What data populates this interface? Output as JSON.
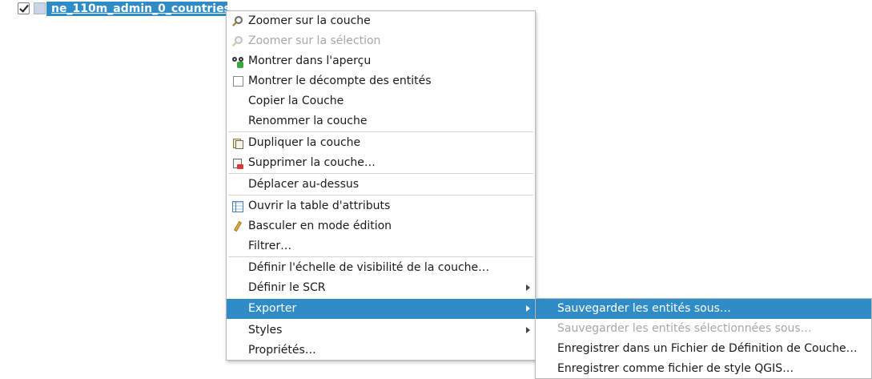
{
  "layer": {
    "name": "ne_110m_admin_0_countries",
    "checked": true
  },
  "menu": {
    "items": [
      {
        "label": "Zoomer sur la couche",
        "icon": "zoom-layer-icon"
      },
      {
        "label": "Zoomer sur la sélection",
        "icon": "zoom-selection-icon",
        "disabled": true
      },
      {
        "label": "Montrer dans l'aperçu",
        "icon": "overview-glasses-icon"
      },
      {
        "label": "Montrer le décompte des entités",
        "icon": "checkbox-icon"
      },
      {
        "label": "Copier la Couche"
      },
      {
        "label": "Renommer la couche"
      },
      {
        "label": "Dupliquer la couche",
        "icon": "duplicate-layer-icon"
      },
      {
        "label": "Supprimer la couche…",
        "icon": "remove-layer-icon"
      },
      {
        "label": "Déplacer au-dessus"
      },
      {
        "label": "Ouvrir la table d'attributs",
        "icon": "attribute-table-icon"
      },
      {
        "label": "Basculer en mode édition",
        "icon": "pencil-icon"
      },
      {
        "label": "Filtrer…"
      },
      {
        "label": "Définir l'échelle de visibilité de la couche…"
      },
      {
        "label": "Définir le SCR",
        "submenu": true
      },
      {
        "label": "Exporter",
        "submenu": true,
        "active": true
      },
      {
        "label": "Styles",
        "submenu": true
      },
      {
        "label": "Propriétés…"
      }
    ]
  },
  "submenu": {
    "items": [
      {
        "label": "Sauvegarder les entités sous…",
        "active": true
      },
      {
        "label": "Sauvegarder les entités sélectionnées sous…",
        "disabled": true
      },
      {
        "label": "Enregistrer dans un Fichier de Définition de Couche…"
      },
      {
        "label": "Enregistrer comme fichier de style QGIS…"
      }
    ]
  },
  "colors": {
    "highlight": "#308cc6",
    "disabled_text": "#a7a7a7"
  }
}
